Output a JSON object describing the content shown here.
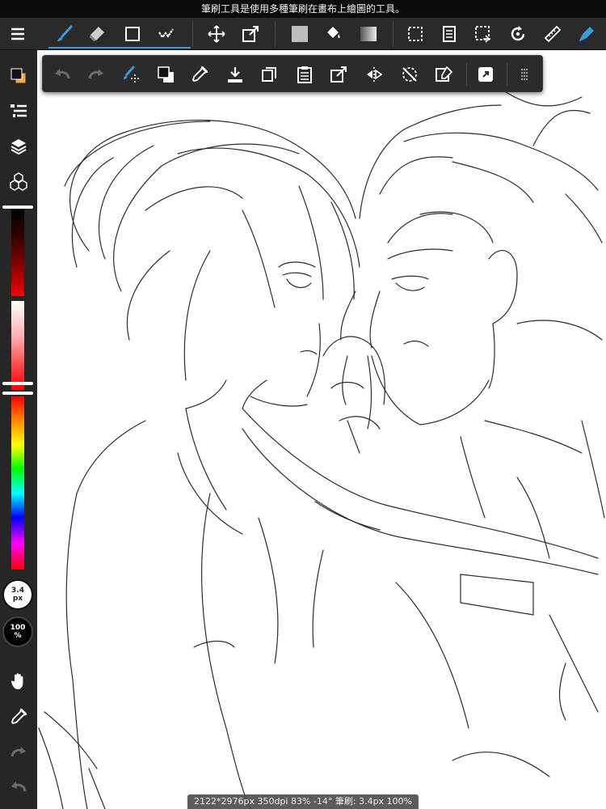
{
  "tipbar": {
    "text": "筆刷工具是使用多種筆刷在畫布上繪圖的工具。"
  },
  "statusbar": {
    "text": "2122*2976px 350dpi 83% -14° 筆刷: 3.4px 100%"
  },
  "brush": {
    "size_value": "3.4",
    "size_unit": "px",
    "opacity_value": "100",
    "opacity_unit": "%"
  },
  "colors": {
    "accent": "#3a9ad9",
    "primary_color": "#111111",
    "secondary_color": "#f5a53a",
    "toolbar_bg": "#2a2a2a",
    "canvas_bg": "#ffffff"
  },
  "main_toolbar": {
    "icons": [
      "menu-icon",
      "brush-icon",
      "eraser-icon",
      "shape-icon",
      "lasso-fill-icon",
      "move-icon",
      "transform-icon",
      "fill-color-icon",
      "bucket-icon",
      "gradient-icon",
      "selection-icon",
      "copy-layer-icon",
      "select-menu-icon",
      "rotate-canvas-icon",
      "ruler-icon",
      "pen-settings-icon"
    ]
  },
  "floating_toolbar": {
    "icons": [
      "undo-icon",
      "redo-icon",
      "brush-cursor-icon",
      "swap-colors-icon",
      "eyedropper-icon",
      "import-icon",
      "duplicate-icon",
      "paste-icon",
      "export-icon",
      "flip-icon",
      "no-selection-icon",
      "clear-icon",
      "snap-icon",
      "grip-icon"
    ]
  },
  "left_panel": {
    "icons": [
      "color-swatch-icon",
      "layer-list-icon",
      "layers-icon",
      "materials-icon",
      "hand-icon",
      "eyedropper-icon",
      "redo-icon",
      "undo-icon"
    ]
  },
  "sliders": {
    "size_position": 0.0,
    "opacity_position": 0.0
  }
}
